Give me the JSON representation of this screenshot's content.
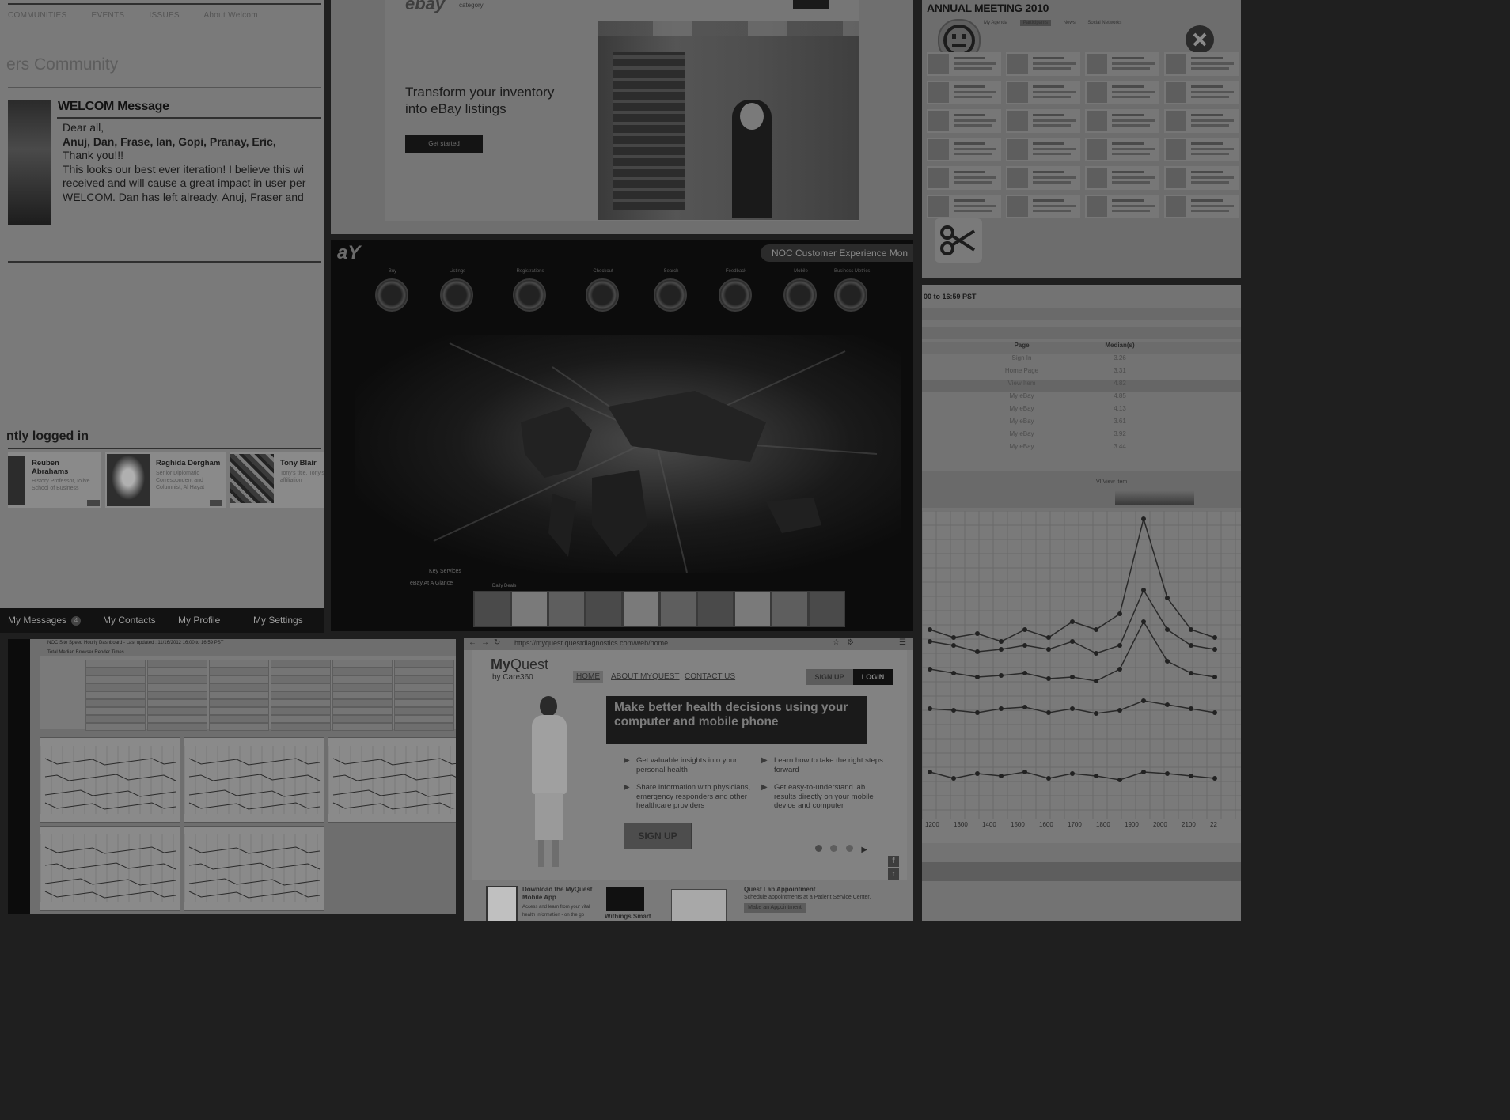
{
  "tile_community": {
    "nav": [
      "COMMUNITIES",
      "EVENTS",
      "ISSUES",
      "About Welcom"
    ],
    "title": "ers Community",
    "welcome_heading": "WELCOM Message",
    "body_lines": [
      "Dear all,",
      "Anuj, Dan, Frase, Ian, Gopi, Pranay, Eric,",
      "Thank you!!!",
      "This looks our best ever iteration! I believe this wi",
      "received and will cause a great impact in user per",
      "WELCOM. Dan has left already, Anuj, Fraser and"
    ],
    "logged_heading": "ntly logged in",
    "cards": [
      {
        "name": "Reuben Abrahams",
        "desc": "History Professor, Iolive School of Business"
      },
      {
        "name": "Raghida Dergham",
        "desc": "Senior Diplomatic Correspondent and Columnist, Al Hayat"
      },
      {
        "name": "Tony Blair",
        "desc": "Tony's title, Tony's affiliation"
      }
    ],
    "footer": [
      "My Messages",
      "My Contacts",
      "My Profile",
      "My Settings"
    ],
    "messages_count": "4"
  },
  "tile_ebay": {
    "logo": "ebay",
    "category": "category",
    "headline_1": "Transform your inventory",
    "headline_2": "into eBay listings",
    "button": "Get started"
  },
  "tile_annual": {
    "title": "ANNUAL MEETING 2010",
    "tabs": [
      "My Agenda",
      "Participants",
      "News",
      "Social Networks"
    ]
  },
  "tile_noc": {
    "brand": "aY",
    "title": "NOC Customer Experience Mon",
    "gauges": [
      "Buy",
      "Listings",
      "Registrations",
      "Checkout",
      "Search",
      "Feedback",
      "Mobile",
      "Business Metrics"
    ],
    "side_links": [
      "Key Services",
      "eBay At A Glance",
      "Daily Deals"
    ]
  },
  "tile_table": {
    "header": "00 to 16:59 PST",
    "col_page": "Page",
    "col_median": "Median(s)",
    "rows": [
      {
        "page": "Sign In",
        "value": "3.26"
      },
      {
        "page": "Home Page",
        "value": "3.31"
      },
      {
        "page": "View Item",
        "value": "4.82"
      },
      {
        "page": "My eBay",
        "value": "4.85"
      },
      {
        "page": "My eBay",
        "value": "4.13"
      },
      {
        "page": "My eBay",
        "value": "3.61"
      },
      {
        "page": "My eBay",
        "value": "3.92"
      },
      {
        "page": "My eBay",
        "value": "3.44"
      }
    ],
    "chart_label": "VI View Item",
    "x_ticks": [
      "1200",
      "1300",
      "1400",
      "1500",
      "1600",
      "1700",
      "1800",
      "1900",
      "2000",
      "2100",
      "22"
    ]
  },
  "tile_dashboard": {
    "title": "NOC Site Speed Hourly Dashboard - Last updated : 11/16/2012 16:00 to 16:59 PST",
    "subtitle": "Total Median Browser Render Times"
  },
  "tile_myquest": {
    "url": "https://myquest.questdiagnostics.com/web/home",
    "logo_my": "My",
    "logo_quest": "Quest",
    "logo_by": "by Care360",
    "nav": [
      "HOME",
      "ABOUT MYQUEST",
      "CONTACT US"
    ],
    "btn_signup_top": "SIGN UP",
    "btn_login": "LOGIN",
    "hero_1": "Make better health decisions using your",
    "hero_2": "computer and mobile phone",
    "bullets": [
      "Get valuable insights into your personal health",
      "Learn how to take the right steps forward",
      "Share information with physicians, emergency responders and other healthcare providers",
      "Get easy-to-understand lab results directly on your mobile device and computer"
    ],
    "signup": "SIGN UP",
    "footer_1_title": "Download the MyQuest Mobile App",
    "footer_1_desc": "Access and learn from your vital health information - on the go",
    "footer_2_title": "Withings Smart",
    "footer_3_title": "Quest Lab Appointment",
    "footer_3_desc": "Schedule appointments at a Patient Service Center.",
    "footer_3_link": "Make an Appointment"
  }
}
